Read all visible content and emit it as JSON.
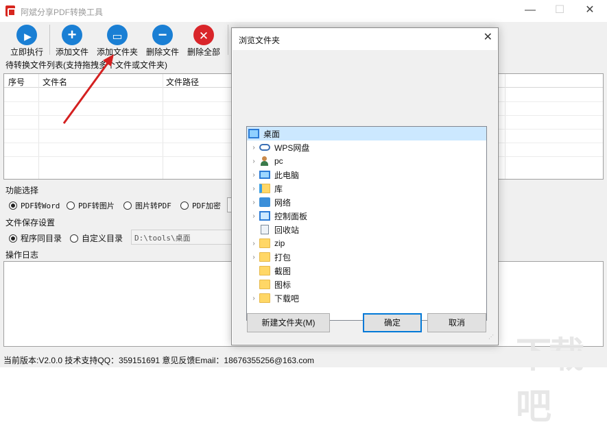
{
  "window": {
    "title": "阿斌分享PDF转换工具",
    "controls": {
      "minimize": "—",
      "maximize": "☐",
      "close": "✕"
    }
  },
  "toolbar": {
    "buttons": [
      {
        "label": "立即执行",
        "icon": "play-icon",
        "color": "#1a7fd4",
        "glyph": "▶"
      },
      {
        "label": "添加文件",
        "icon": "plus-icon",
        "color": "#1a7fd4",
        "glyph": "+"
      },
      {
        "label": "添加文件夹",
        "icon": "folder-icon",
        "color": "#1a7fd4",
        "glyph": "▭"
      },
      {
        "label": "删除文件",
        "icon": "minus-icon",
        "color": "#1a7fd4",
        "glyph": "−"
      },
      {
        "label": "删除全部",
        "icon": "close-icon",
        "color": "#d9252a",
        "glyph": "✕"
      }
    ]
  },
  "file_list": {
    "label": "待转换文件列表(支持拖拽多个文件或文件夹)",
    "columns": [
      "序号",
      "文件名",
      "文件路径"
    ]
  },
  "functions": {
    "label": "功能选择",
    "options": [
      {
        "label": "PDF转Word",
        "selected": true
      },
      {
        "label": "PDF转图片",
        "selected": false
      },
      {
        "label": "图片转PDF",
        "selected": false
      },
      {
        "label": "PDF加密",
        "selected": false
      }
    ]
  },
  "save": {
    "label": "文件保存设置",
    "options": [
      {
        "label": "程序同目录",
        "selected": true
      },
      {
        "label": "自定义目录",
        "selected": false
      }
    ],
    "path": "D:\\tools\\桌面"
  },
  "log": {
    "label": "操作日志"
  },
  "status": {
    "text": "当前版本:V2.0.0  技术支持QQ：359151691  意见反馈Email：18676355256@163.com"
  },
  "watermark": "下载吧",
  "dialog": {
    "title": "浏览文件夹",
    "close": "✕",
    "tree": [
      {
        "label": "桌面",
        "icon": "desktop-icon",
        "expander": false,
        "root": true
      },
      {
        "label": "WPS网盘",
        "icon": "cloud-icon",
        "expander": true
      },
      {
        "label": "pc",
        "icon": "user-icon",
        "expander": true
      },
      {
        "label": "此电脑",
        "icon": "computer-icon",
        "expander": true
      },
      {
        "label": "库",
        "icon": "library-icon",
        "expander": true
      },
      {
        "label": "网络",
        "icon": "network-icon",
        "expander": true
      },
      {
        "label": "控制面板",
        "icon": "control-panel-icon",
        "expander": true
      },
      {
        "label": "回收站",
        "icon": "recycle-bin-icon",
        "expander": false
      },
      {
        "label": "zip",
        "icon": "folder-icon",
        "expander": true
      },
      {
        "label": "打包",
        "icon": "folder-icon",
        "expander": true
      },
      {
        "label": "截图",
        "icon": "folder-icon",
        "expander": false
      },
      {
        "label": "图标",
        "icon": "folder-icon",
        "expander": false
      },
      {
        "label": "下载吧",
        "icon": "folder-icon",
        "expander": true
      }
    ],
    "buttons": {
      "new_folder": "新建文件夹(M)",
      "ok": "确定",
      "cancel": "取消"
    }
  }
}
